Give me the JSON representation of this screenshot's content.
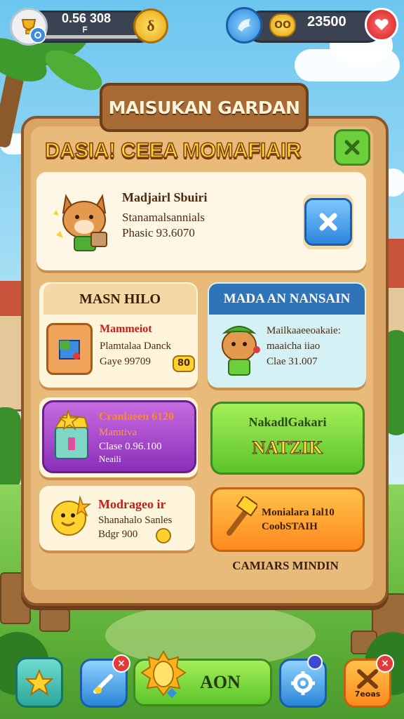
{
  "hud": {
    "left_counter": "0.56 308",
    "left_subtext": "ᖴ",
    "right_counter": "23500",
    "currency_icon": "coin-icon",
    "colors": {
      "bar": "#3b4252",
      "accent_gold": "#f5c518",
      "accent_red": "#e23a3a"
    }
  },
  "panel": {
    "title": "MAISUKAN GARDAN",
    "subtitle": "DASIA! CEEA MOMAFIAIR",
    "feature_card": {
      "title": "Madjairl Sbuiri",
      "line1": "Stanamalsannials",
      "line2": "Phasic 93.6070"
    },
    "left_header": "MASN HILO",
    "right_header": "MADA AN NANSAIN",
    "item_card_1": {
      "title": "Mammeiot",
      "line1": "Plamtalaa Danck",
      "line2": "Gaye 99709",
      "badge": "80"
    },
    "item_card_2": {
      "title": "Mailkaaeeoakaie:",
      "line1": "maaicha iiao",
      "line2": "Clae 31.007"
    },
    "item_card_3": {
      "title": "Cranlaeen 6120",
      "line1": "Mamtiva",
      "line2": "Clase 0.96.100",
      "line3": "Neaili"
    },
    "green_button": {
      "top_label": "NakadlGakari",
      "main_label": "NATZIK"
    },
    "item_card_4": {
      "title": "Modrageo ir",
      "line1": "Shanahalo Sanles",
      "line2": "Bdgr 900"
    },
    "orange_button": {
      "line1": "Monialara Ial10",
      "line2": "CoobSTAIH"
    },
    "footer_label": "CAMIARS MINDIN"
  },
  "bottom_bar": {
    "main_button_label": "AON",
    "right_button_label": "7eoas",
    "badge_1": "×",
    "badge_2": "×"
  }
}
